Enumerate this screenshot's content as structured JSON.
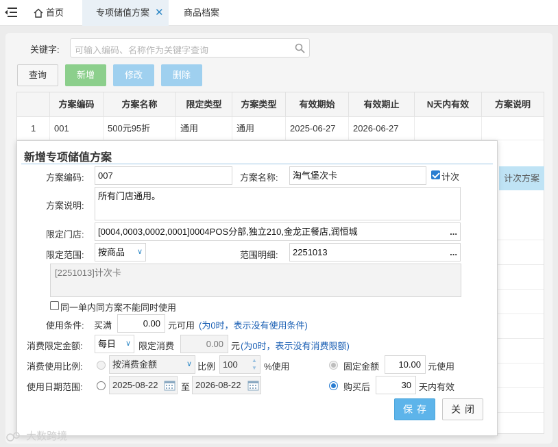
{
  "tabs": {
    "home": "首页",
    "plan": "专项储值方案",
    "plan_close": "✕",
    "goods": "商品档案"
  },
  "search": {
    "label": "关键字:",
    "placeholder": "可输入编码、名称作为关键字查询"
  },
  "toolbar": {
    "query": "查询",
    "add": "新增",
    "edit": "修改",
    "delete": "删除"
  },
  "grid": {
    "headers": [
      "方案编码",
      "方案名称",
      "限定类型",
      "方案类型",
      "有效期始",
      "有效期止",
      "N天内有效",
      "方案说明"
    ],
    "rows": [
      {
        "index": "1",
        "code": "001",
        "name": "500元95折",
        "limit_type": "通用",
        "plan_type": "通用",
        "start": "2025-06-27",
        "end": "2026-06-27",
        "n_days": "",
        "desc": ""
      }
    ],
    "highlight_desc": "计次方案"
  },
  "dialog": {
    "title": "新增专项储值方案",
    "code_label": "方案编码:",
    "code_value": "007",
    "name_label": "方案名称:",
    "name_value": "淘气堡次卡",
    "count_label": "计次",
    "count_checked": true,
    "desc_label": "方案说明:",
    "desc_value": "所有门店通用。",
    "store_label": "限定门店:",
    "store_value": "[0004,0003,0002,0001]0004POS分部,独立210,金龙正餐店,润恒城",
    "scope_label": "限定范围:",
    "scope_value": "按商品",
    "scope_detail_label": "范围明细:",
    "scope_detail_value": "2251013",
    "scope_preview": "[2251013]计次卡",
    "same_order_label": "同一单内同方案不能同时使用",
    "cond_label": "使用条件:",
    "cond_prefix": "买满",
    "cond_value": "0.00",
    "cond_suffix": "元可用",
    "cond_hint": "(为0时，表示没有使用条件)",
    "limit_label": "消费限定金额:",
    "limit_period": "每日",
    "limit_prefix": "限定消费",
    "limit_value": "0.00",
    "limit_suffix": "元",
    "limit_hint": "(为0时，表示没有消费限额)",
    "ratio_label": "消费使用比例:",
    "ratio_mode": "按消费金额",
    "ratio_prefix": "比例",
    "ratio_value": "100",
    "ratio_suffix": "%使用",
    "fixed_label": "固定金额",
    "fixed_value": "10.00",
    "fixed_suffix": "元使用",
    "date_label": "使用日期范围:",
    "date_from": "2025-08-22",
    "date_to_label": "至",
    "date_to": "2026-08-22",
    "after_buy_label": "购买后",
    "after_buy_value": "30",
    "after_buy_suffix": "天内有效",
    "save": "保存",
    "close": "关闭"
  },
  "watermark": "大数跨境",
  "colors": {
    "accent": "#2b86c5",
    "save_button": "#5db4ea",
    "add_button": "#8ccf8c",
    "hint_text": "#1a5fb4"
  }
}
